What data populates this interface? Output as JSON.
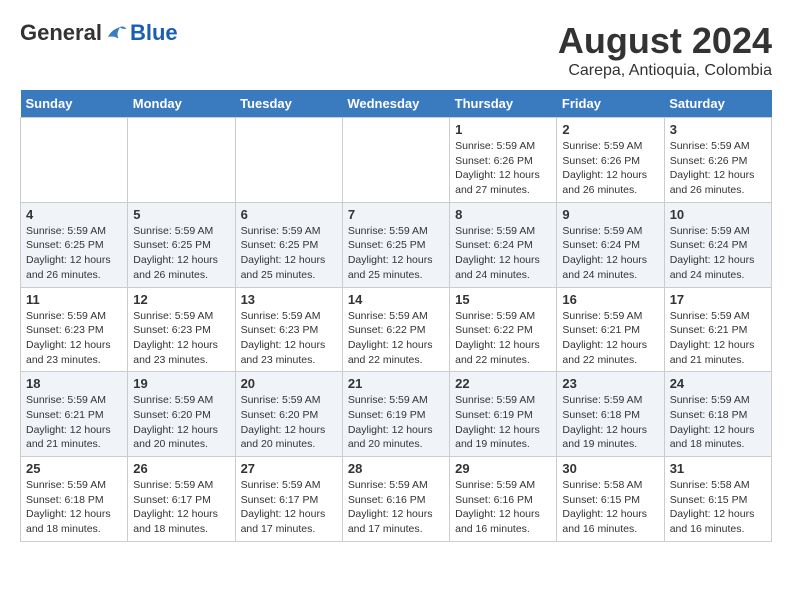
{
  "header": {
    "logo_general": "General",
    "logo_blue": "Blue",
    "month_year": "August 2024",
    "location": "Carepa, Antioquia, Colombia"
  },
  "days_of_week": [
    "Sunday",
    "Monday",
    "Tuesday",
    "Wednesday",
    "Thursday",
    "Friday",
    "Saturday"
  ],
  "weeks": [
    {
      "days": [
        {
          "num": "",
          "info": ""
        },
        {
          "num": "",
          "info": ""
        },
        {
          "num": "",
          "info": ""
        },
        {
          "num": "",
          "info": ""
        },
        {
          "num": "1",
          "info": "Sunrise: 5:59 AM\nSunset: 6:26 PM\nDaylight: 12 hours\nand 27 minutes."
        },
        {
          "num": "2",
          "info": "Sunrise: 5:59 AM\nSunset: 6:26 PM\nDaylight: 12 hours\nand 26 minutes."
        },
        {
          "num": "3",
          "info": "Sunrise: 5:59 AM\nSunset: 6:26 PM\nDaylight: 12 hours\nand 26 minutes."
        }
      ]
    },
    {
      "days": [
        {
          "num": "4",
          "info": "Sunrise: 5:59 AM\nSunset: 6:25 PM\nDaylight: 12 hours\nand 26 minutes."
        },
        {
          "num": "5",
          "info": "Sunrise: 5:59 AM\nSunset: 6:25 PM\nDaylight: 12 hours\nand 26 minutes."
        },
        {
          "num": "6",
          "info": "Sunrise: 5:59 AM\nSunset: 6:25 PM\nDaylight: 12 hours\nand 25 minutes."
        },
        {
          "num": "7",
          "info": "Sunrise: 5:59 AM\nSunset: 6:25 PM\nDaylight: 12 hours\nand 25 minutes."
        },
        {
          "num": "8",
          "info": "Sunrise: 5:59 AM\nSunset: 6:24 PM\nDaylight: 12 hours\nand 24 minutes."
        },
        {
          "num": "9",
          "info": "Sunrise: 5:59 AM\nSunset: 6:24 PM\nDaylight: 12 hours\nand 24 minutes."
        },
        {
          "num": "10",
          "info": "Sunrise: 5:59 AM\nSunset: 6:24 PM\nDaylight: 12 hours\nand 24 minutes."
        }
      ]
    },
    {
      "days": [
        {
          "num": "11",
          "info": "Sunrise: 5:59 AM\nSunset: 6:23 PM\nDaylight: 12 hours\nand 23 minutes."
        },
        {
          "num": "12",
          "info": "Sunrise: 5:59 AM\nSunset: 6:23 PM\nDaylight: 12 hours\nand 23 minutes."
        },
        {
          "num": "13",
          "info": "Sunrise: 5:59 AM\nSunset: 6:23 PM\nDaylight: 12 hours\nand 23 minutes."
        },
        {
          "num": "14",
          "info": "Sunrise: 5:59 AM\nSunset: 6:22 PM\nDaylight: 12 hours\nand 22 minutes."
        },
        {
          "num": "15",
          "info": "Sunrise: 5:59 AM\nSunset: 6:22 PM\nDaylight: 12 hours\nand 22 minutes."
        },
        {
          "num": "16",
          "info": "Sunrise: 5:59 AM\nSunset: 6:21 PM\nDaylight: 12 hours\nand 22 minutes."
        },
        {
          "num": "17",
          "info": "Sunrise: 5:59 AM\nSunset: 6:21 PM\nDaylight: 12 hours\nand 21 minutes."
        }
      ]
    },
    {
      "days": [
        {
          "num": "18",
          "info": "Sunrise: 5:59 AM\nSunset: 6:21 PM\nDaylight: 12 hours\nand 21 minutes."
        },
        {
          "num": "19",
          "info": "Sunrise: 5:59 AM\nSunset: 6:20 PM\nDaylight: 12 hours\nand 20 minutes."
        },
        {
          "num": "20",
          "info": "Sunrise: 5:59 AM\nSunset: 6:20 PM\nDaylight: 12 hours\nand 20 minutes."
        },
        {
          "num": "21",
          "info": "Sunrise: 5:59 AM\nSunset: 6:19 PM\nDaylight: 12 hours\nand 20 minutes."
        },
        {
          "num": "22",
          "info": "Sunrise: 5:59 AM\nSunset: 6:19 PM\nDaylight: 12 hours\nand 19 minutes."
        },
        {
          "num": "23",
          "info": "Sunrise: 5:59 AM\nSunset: 6:18 PM\nDaylight: 12 hours\nand 19 minutes."
        },
        {
          "num": "24",
          "info": "Sunrise: 5:59 AM\nSunset: 6:18 PM\nDaylight: 12 hours\nand 18 minutes."
        }
      ]
    },
    {
      "days": [
        {
          "num": "25",
          "info": "Sunrise: 5:59 AM\nSunset: 6:18 PM\nDaylight: 12 hours\nand 18 minutes."
        },
        {
          "num": "26",
          "info": "Sunrise: 5:59 AM\nSunset: 6:17 PM\nDaylight: 12 hours\nand 18 minutes."
        },
        {
          "num": "27",
          "info": "Sunrise: 5:59 AM\nSunset: 6:17 PM\nDaylight: 12 hours\nand 17 minutes."
        },
        {
          "num": "28",
          "info": "Sunrise: 5:59 AM\nSunset: 6:16 PM\nDaylight: 12 hours\nand 17 minutes."
        },
        {
          "num": "29",
          "info": "Sunrise: 5:59 AM\nSunset: 6:16 PM\nDaylight: 12 hours\nand 16 minutes."
        },
        {
          "num": "30",
          "info": "Sunrise: 5:58 AM\nSunset: 6:15 PM\nDaylight: 12 hours\nand 16 minutes."
        },
        {
          "num": "31",
          "info": "Sunrise: 5:58 AM\nSunset: 6:15 PM\nDaylight: 12 hours\nand 16 minutes."
        }
      ]
    }
  ]
}
